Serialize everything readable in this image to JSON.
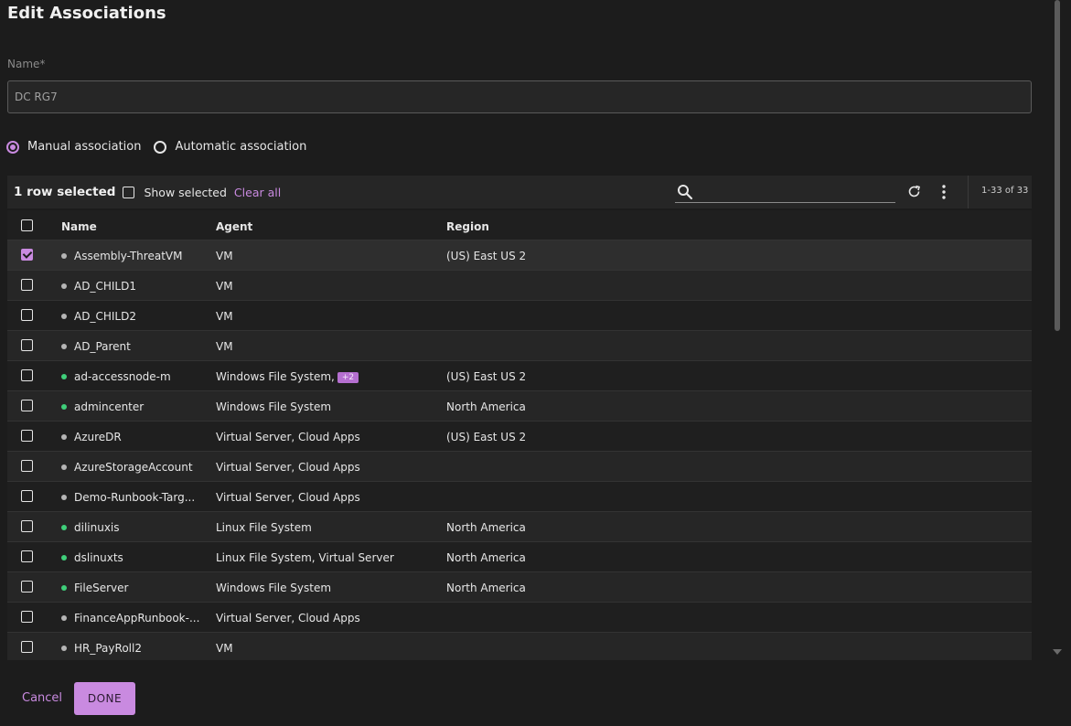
{
  "dialog": {
    "title": "Edit Associations",
    "name_label": "Name",
    "name_required_marker": "*",
    "name_value": "DC RG7"
  },
  "association": {
    "options": [
      {
        "label": "Manual association",
        "selected": true
      },
      {
        "label": "Automatic association",
        "selected": false
      }
    ]
  },
  "toolbar": {
    "selected_count": "1 row selected",
    "show_selected_label": "Show selected",
    "clear_all_label": "Clear all",
    "search_value": "",
    "pager_text": "1-33 of 33"
  },
  "table": {
    "columns": [
      "Name",
      "Agent",
      "Region"
    ],
    "rows": [
      {
        "name": "Assembly-ThreatVM",
        "agent": "VM",
        "badge": "",
        "region": "(US) East US 2",
        "status": "gray",
        "checked": true
      },
      {
        "name": "AD_CHILD1",
        "agent": "VM",
        "badge": "",
        "region": "",
        "status": "gray",
        "checked": false
      },
      {
        "name": "AD_CHILD2",
        "agent": "VM",
        "badge": "",
        "region": "",
        "status": "gray",
        "checked": false
      },
      {
        "name": "AD_Parent",
        "agent": "VM",
        "badge": "",
        "region": "",
        "status": "gray",
        "checked": false
      },
      {
        "name": "ad-accessnode-m",
        "agent": "Windows File System,",
        "badge": "+2",
        "region": "(US) East US 2",
        "status": "green",
        "checked": false
      },
      {
        "name": "admincenter",
        "agent": "Windows File System",
        "badge": "",
        "region": "North America",
        "status": "green",
        "checked": false
      },
      {
        "name": "AzureDR",
        "agent": "Virtual Server, Cloud Apps",
        "badge": "",
        "region": "(US) East US 2",
        "status": "gray",
        "checked": false
      },
      {
        "name": "AzureStorageAccount",
        "agent": "Virtual Server, Cloud Apps",
        "badge": "",
        "region": "",
        "status": "gray",
        "checked": false
      },
      {
        "name": "Demo-Runbook-Targ...",
        "agent": "Virtual Server, Cloud Apps",
        "badge": "",
        "region": "",
        "status": "gray",
        "checked": false
      },
      {
        "name": "dilinuxis",
        "agent": "Linux File System",
        "badge": "",
        "region": "North America",
        "status": "green",
        "checked": false
      },
      {
        "name": "dslinuxts",
        "agent": "Linux File System, Virtual Server",
        "badge": "",
        "region": "North America",
        "status": "green",
        "checked": false
      },
      {
        "name": "FileServer",
        "agent": "Windows File System",
        "badge": "",
        "region": "North America",
        "status": "green",
        "checked": false
      },
      {
        "name": "FinanceAppRunbook-...",
        "agent": "Virtual Server, Cloud Apps",
        "badge": "",
        "region": "",
        "status": "gray",
        "checked": false
      },
      {
        "name": "HR_PayRoll2",
        "agent": "VM",
        "badge": "",
        "region": "",
        "status": "gray",
        "checked": false
      }
    ]
  },
  "footer": {
    "cancel_label": "Cancel",
    "done_label": "DONE"
  },
  "colors": {
    "accent": "#c98ae0",
    "status_green": "#3fcf7a",
    "status_gray": "#b5b5b5",
    "background": "#1c1c1c"
  },
  "icons": {
    "search": "search-icon",
    "refresh": "refresh-icon",
    "more": "kebab-menu-icon"
  }
}
